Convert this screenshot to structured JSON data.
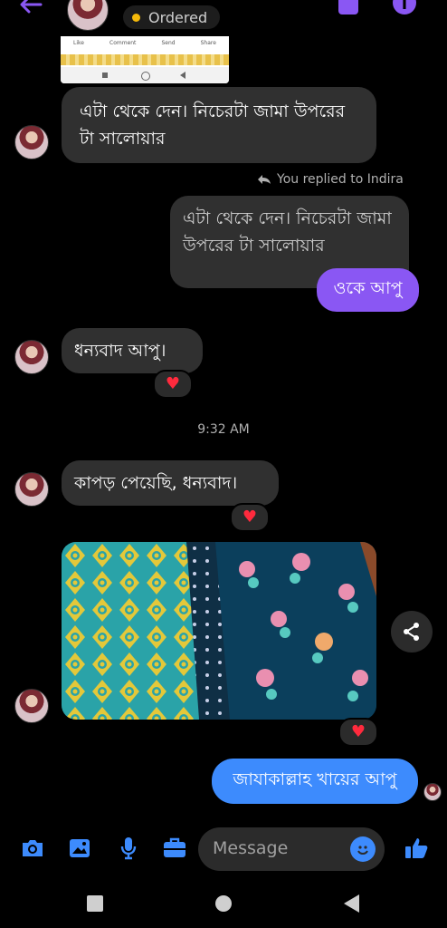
{
  "header": {
    "back_icon": "arrow-left-icon",
    "status_label": "Ordered",
    "status_dot_color": "#f5b90a",
    "accent": "#8a57f3"
  },
  "preview_card": {
    "actions": [
      "Like",
      "Comment",
      "Send",
      "Share"
    ]
  },
  "messages": {
    "m1": "এটা থেকে দেন। নিচেরটা জামা উপরের টা সালোয়ার",
    "reply_label": "You replied to Indira",
    "quoted": "এটা থেকে দেন। নিচেরটা জামা উপরের টা সালোয়ার",
    "reply": "ওকে আপু",
    "m2": "ধন্যবাদ আপু।",
    "time": "9:32 AM",
    "m3": "কাপড় পেয়েছি, ধন্যবাদ।",
    "last": "জাযাকাল্লাহ খায়ের আপু"
  },
  "composer": {
    "placeholder": "Message"
  },
  "colors": {
    "incoming_bubble": "#303030",
    "outgoing_blue": "#3d8bfd",
    "outgoing_purple": "#8a57f3",
    "icon_blue": "#3d8bfd",
    "reaction": "#ff2a3d"
  }
}
